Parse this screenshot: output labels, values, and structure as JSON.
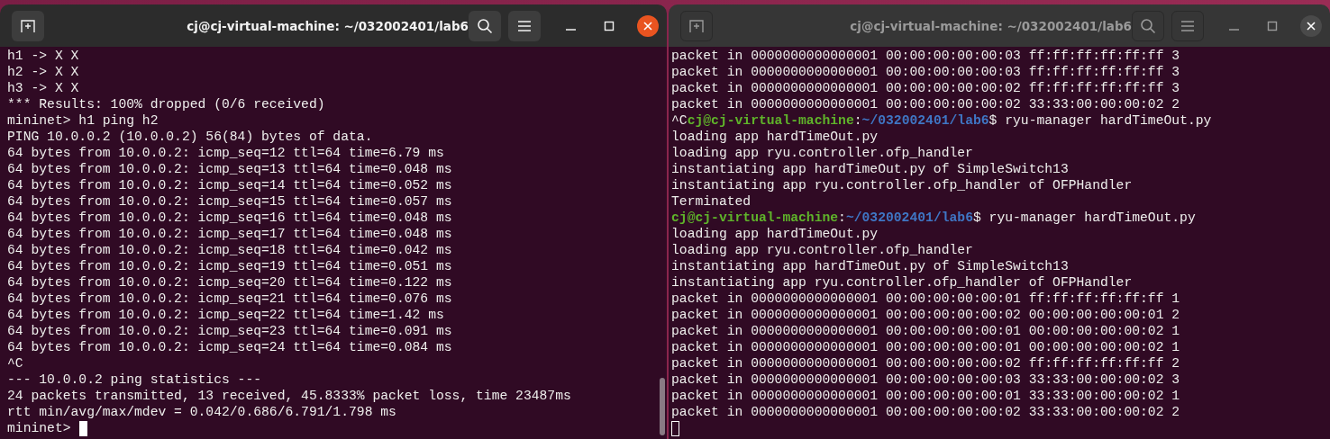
{
  "windows": [
    {
      "title": "cj@cj-virtual-machine: ~/032002401/lab6",
      "focused": true,
      "lines": [
        {
          "text": "h1 -> X X"
        },
        {
          "text": "h2 -> X X"
        },
        {
          "text": "h3 -> X X"
        },
        {
          "text": "*** Results: 100% dropped (0/6 received)"
        },
        {
          "text": "mininet> h1 ping h2"
        },
        {
          "text": "PING 10.0.0.2 (10.0.0.2) 56(84) bytes of data."
        },
        {
          "text": "64 bytes from 10.0.0.2: icmp_seq=12 ttl=64 time=6.79 ms"
        },
        {
          "text": "64 bytes from 10.0.0.2: icmp_seq=13 ttl=64 time=0.048 ms"
        },
        {
          "text": "64 bytes from 10.0.0.2: icmp_seq=14 ttl=64 time=0.052 ms"
        },
        {
          "text": "64 bytes from 10.0.0.2: icmp_seq=15 ttl=64 time=0.057 ms"
        },
        {
          "text": "64 bytes from 10.0.0.2: icmp_seq=16 ttl=64 time=0.048 ms"
        },
        {
          "text": "64 bytes from 10.0.0.2: icmp_seq=17 ttl=64 time=0.048 ms"
        },
        {
          "text": "64 bytes from 10.0.0.2: icmp_seq=18 ttl=64 time=0.042 ms"
        },
        {
          "text": "64 bytes from 10.0.0.2: icmp_seq=19 ttl=64 time=0.051 ms"
        },
        {
          "text": "64 bytes from 10.0.0.2: icmp_seq=20 ttl=64 time=0.122 ms"
        },
        {
          "text": "64 bytes from 10.0.0.2: icmp_seq=21 ttl=64 time=0.076 ms"
        },
        {
          "text": "64 bytes from 10.0.0.2: icmp_seq=22 ttl=64 time=1.42 ms"
        },
        {
          "text": "64 bytes from 10.0.0.2: icmp_seq=23 ttl=64 time=0.091 ms"
        },
        {
          "text": "64 bytes from 10.0.0.2: icmp_seq=24 ttl=64 time=0.084 ms"
        },
        {
          "text": "^C"
        },
        {
          "text": "--- 10.0.0.2 ping statistics ---"
        },
        {
          "text": "24 packets transmitted, 13 received, 45.8333% packet loss, time 23487ms"
        },
        {
          "text": "rtt min/avg/max/mdev = 0.042/0.686/6.791/1.798 ms"
        }
      ],
      "prompt": "mininet>"
    },
    {
      "title": "cj@cj-virtual-machine: ~/032002401/lab6",
      "focused": false,
      "lines": [
        {
          "text": "packet in 0000000000000001 00:00:00:00:00:03 ff:ff:ff:ff:ff:ff 3"
        },
        {
          "text": "packet in 0000000000000001 00:00:00:00:00:03 ff:ff:ff:ff:ff:ff 3"
        },
        {
          "text": "packet in 0000000000000001 00:00:00:00:00:02 ff:ff:ff:ff:ff:ff 3"
        },
        {
          "text": "packet in 0000000000000001 00:00:00:00:00:02 33:33:00:00:00:02 2"
        },
        {
          "parts": [
            {
              "text": "^C",
              "kind": "plain"
            },
            {
              "text": "cj@cj-virtual-machine",
              "kind": "user"
            },
            {
              "text": ":",
              "kind": "plain"
            },
            {
              "text": "~/032002401/lab6",
              "kind": "path"
            },
            {
              "text": "$ ryu-manager hardTimeOut.py",
              "kind": "plain"
            }
          ]
        },
        {
          "text": "loading app hardTimeOut.py"
        },
        {
          "text": "loading app ryu.controller.ofp_handler"
        },
        {
          "text": "instantiating app hardTimeOut.py of SimpleSwitch13"
        },
        {
          "text": "instantiating app ryu.controller.ofp_handler of OFPHandler"
        },
        {
          "text": "Terminated"
        },
        {
          "parts": [
            {
              "text": "cj@cj-virtual-machine",
              "kind": "user"
            },
            {
              "text": ":",
              "kind": "plain"
            },
            {
              "text": "~/032002401/lab6",
              "kind": "path"
            },
            {
              "text": "$ ryu-manager hardTimeOut.py",
              "kind": "plain"
            }
          ]
        },
        {
          "text": "loading app hardTimeOut.py"
        },
        {
          "text": "loading app ryu.controller.ofp_handler"
        },
        {
          "text": "instantiating app hardTimeOut.py of SimpleSwitch13"
        },
        {
          "text": "instantiating app ryu.controller.ofp_handler of OFPHandler"
        },
        {
          "text": "packet in 0000000000000001 00:00:00:00:00:01 ff:ff:ff:ff:ff:ff 1"
        },
        {
          "text": "packet in 0000000000000001 00:00:00:00:00:02 00:00:00:00:00:01 2"
        },
        {
          "text": "packet in 0000000000000001 00:00:00:00:00:01 00:00:00:00:00:02 1"
        },
        {
          "text": "packet in 0000000000000001 00:00:00:00:00:01 00:00:00:00:00:02 1"
        },
        {
          "text": "packet in 0000000000000001 00:00:00:00:00:02 ff:ff:ff:ff:ff:ff 2"
        },
        {
          "text": "packet in 0000000000000001 00:00:00:00:00:03 33:33:00:00:00:02 3"
        },
        {
          "text": "packet in 0000000000000001 00:00:00:00:00:01 33:33:00:00:00:02 1"
        },
        {
          "text": "packet in 0000000000000001 00:00:00:00:00:02 33:33:00:00:00:02 2"
        }
      ]
    }
  ]
}
